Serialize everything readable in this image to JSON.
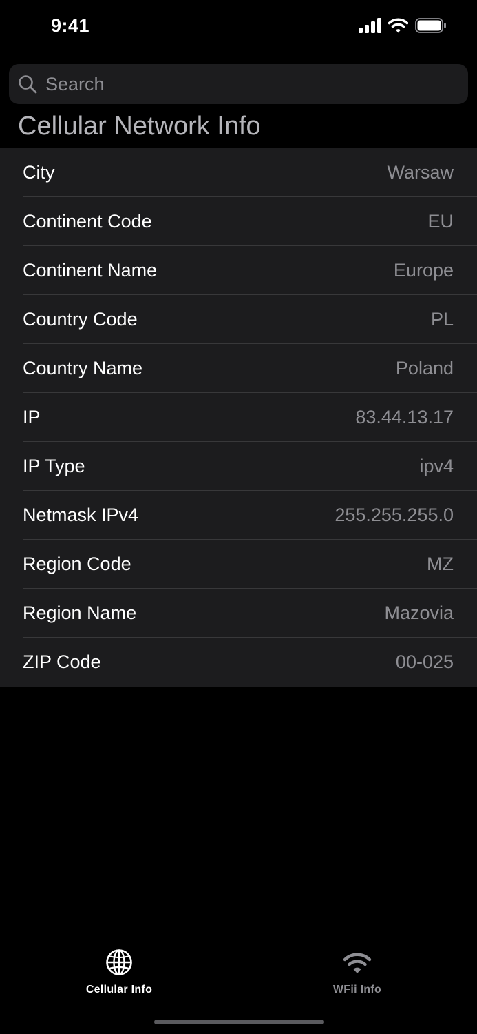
{
  "status_bar": {
    "time": "9:41"
  },
  "search": {
    "placeholder": "Search",
    "value": ""
  },
  "section": {
    "title": "Cellular Network Info"
  },
  "rows": [
    {
      "label": "City",
      "value": "Warsaw"
    },
    {
      "label": "Continent Code",
      "value": "EU"
    },
    {
      "label": "Continent Name",
      "value": "Europe"
    },
    {
      "label": "Country Code",
      "value": "PL"
    },
    {
      "label": "Country Name",
      "value": "Poland"
    },
    {
      "label": "IP",
      "value": "83.44.13.17"
    },
    {
      "label": "IP Type",
      "value": "ipv4"
    },
    {
      "label": "Netmask IPv4",
      "value": "255.255.255.0"
    },
    {
      "label": "Region Code",
      "value": "MZ"
    },
    {
      "label": "Region Name",
      "value": "Mazovia"
    },
    {
      "label": "ZIP Code",
      "value": "00-025"
    }
  ],
  "tabs": [
    {
      "label": "Cellular Info",
      "icon": "globe-icon",
      "active": true
    },
    {
      "label": "WFii Info",
      "icon": "wifi-icon",
      "active": false
    }
  ],
  "colors": {
    "background": "#000000",
    "cell": "#1c1c1e",
    "secondary_text": "#8e8e93",
    "separator": "#38383a"
  }
}
